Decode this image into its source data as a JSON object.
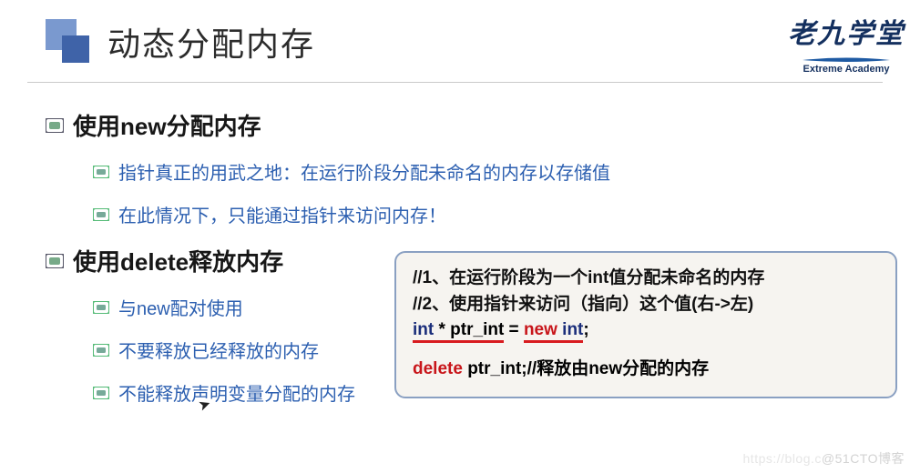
{
  "logo": {
    "cn": "老九学堂",
    "en": "Extreme Academy"
  },
  "title": "动态分配内存",
  "sections": [
    {
      "title": "使用new分配内存",
      "items": [
        "指针真正的用武之地：在运行阶段分配未命名的内存以存储值",
        "在此情况下，只能通过指针来访问内存！"
      ]
    },
    {
      "title": "使用delete释放内存",
      "items": [
        "与new配对使用",
        "不要释放已经释放的内存",
        "不能释放声明变量分配的内存"
      ]
    }
  ],
  "code": {
    "c1": "//1、在运行阶段为一个int值分配未命名的内存",
    "c2": "//2、使用指针来访问（指向）这个值(右->左)",
    "int_kw": "int",
    "decl_rest": " * ptr_int",
    "eq": " = ",
    "new_kw": "new",
    "new_space": " ",
    "int_kw2": "int",
    "semi": ";",
    "delete_kw": "delete",
    "del_rest": " ptr_int;//释放由new分配的内存"
  },
  "watermark": {
    "pre": "https://blog.c",
    "main": "@51CTO博客"
  }
}
